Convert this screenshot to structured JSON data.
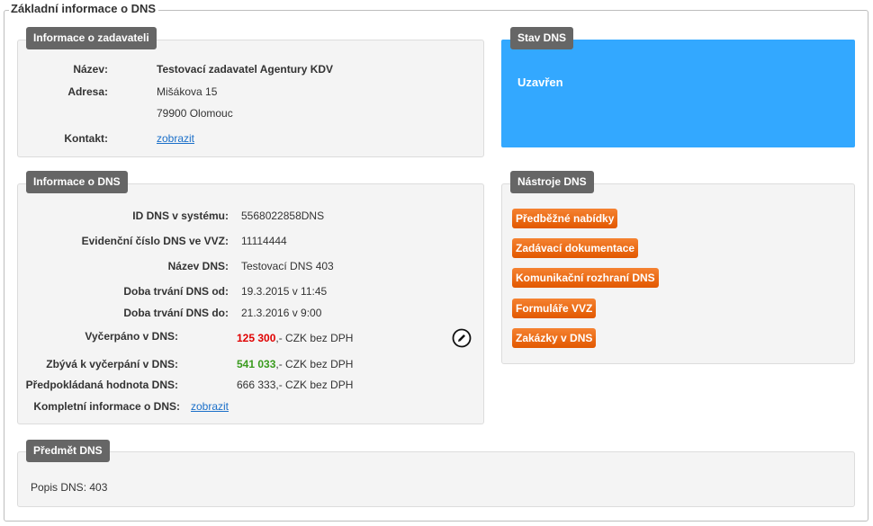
{
  "main_legend": "Základní informace o DNS",
  "zadavatel": {
    "title": "Informace o zadavateli",
    "name_label": "Název:",
    "name": "Testovací zadavatel Agentury KDV",
    "address_label": "Adresa:",
    "street": "Mišákova 15",
    "city": "79900 Olomouc",
    "contact_label": "Kontakt:",
    "contact_link": "zobrazit"
  },
  "stav": {
    "title": "Stav DNS",
    "value": "Uzavřen",
    "color": "#33a8ff"
  },
  "dns_info": {
    "title": "Informace o DNS",
    "id_label": "ID DNS v systému:",
    "id": "5568022858DNS",
    "evid_label": "Evidenční číslo DNS ve VVZ:",
    "evid": "11114444",
    "name_label": "Název DNS:",
    "name": "Testovací DNS 403",
    "from_label": "Doba trvání DNS od:",
    "from": "19.3.2015 v 11:45",
    "to_label": "Doba trvání DNS do:",
    "to": "21.3.2016 v 9:00",
    "spent_label": "Vyčerpáno v DNS:",
    "spent_amount": "125 300",
    "spent_suffix": ",- CZK bez DPH",
    "remain_label": "Zbývá k vyčerpání v DNS:",
    "remain_amount": "541 033",
    "remain_suffix": ",- CZK bez DPH",
    "expected_label": "Předpokládaná hodnota DNS:",
    "expected": "666 333,- CZK bez DPH",
    "full_label": "Kompletní informace o DNS:",
    "full_link": "zobrazit",
    "edit_icon": "pencil-circle-icon"
  },
  "tools": {
    "title": "Nástroje DNS",
    "buttons": [
      "Předběžné nabídky",
      "Zadávací dokumentace",
      "Komunikační rozhraní DNS",
      "Formuláře VVZ",
      "Zakázky v DNS"
    ],
    "button_color": "#ee6611"
  },
  "predmet": {
    "title": "Předmět DNS",
    "text": "Popis DNS: 403"
  }
}
